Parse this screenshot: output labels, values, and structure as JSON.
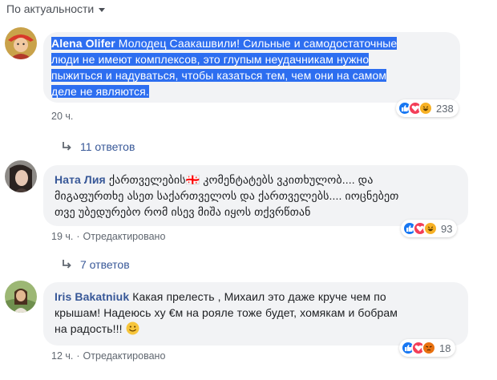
{
  "sort": {
    "label": "По актуальности"
  },
  "comments": [
    {
      "author": "Alena Olifer",
      "text": " Молодец Саакашвили! Сильные и самодостаточные люди не имеют комплексов, это глупым неудачникам нужно пыжиться и надуваться, чтобы казаться тем, чем они на самом деле не являются.",
      "lines": [
        "Молодец Саакашвили! Сильные и самодостаточные",
        "люди не имеют комплексов, это глупым неудачникам нужно",
        "пыжиться и надуваться, чтобы казаться тем, чем они на самом",
        "деле не являются."
      ],
      "time": "20 ч.",
      "edited": "",
      "reaction_count": "238",
      "reactions": [
        "like-icon",
        "love-icon",
        "haha-icon"
      ],
      "replies_label": "11 ответов"
    },
    {
      "author": "Ната Лия",
      "lines": [
        "ქართველების🇬🇪 კომენტატებს ვკითხულობ.... და",
        "მიგაფურთხე ასეთ საქართველოს და ქართველებს.... იოცნებეთ",
        "თვე უბედურებო რომ ისევ მიშა იყოს თქვრწთან"
      ],
      "time": "19 ч.",
      "edited": "Отредактировано",
      "reaction_count": "93",
      "reactions": [
        "like-icon",
        "love-icon",
        "haha-icon"
      ],
      "replies_label": "7 ответов"
    },
    {
      "author": "Iris Bakatniuk",
      "lines": [
        "Какая прелесть , Михаил это даже круче чем по",
        "крышам! Надеюсь ху €м на рояле тоже будет, хомякам и бобрам",
        "на радость!!!"
      ],
      "time": "12 ч.",
      "edited": "Отредактировано",
      "reaction_count": "18",
      "reactions": [
        "like-icon",
        "love-icon",
        "angry-icon"
      ],
      "replies_label": ""
    }
  ],
  "colors": {
    "link": "#385898",
    "meta": "#606770",
    "bubble": "#f2f3f5",
    "selection": "#2d6ef0",
    "like": "#1877f2",
    "love": "#f33e58",
    "haha": "#f7b125",
    "angry": "#e9710f"
  }
}
